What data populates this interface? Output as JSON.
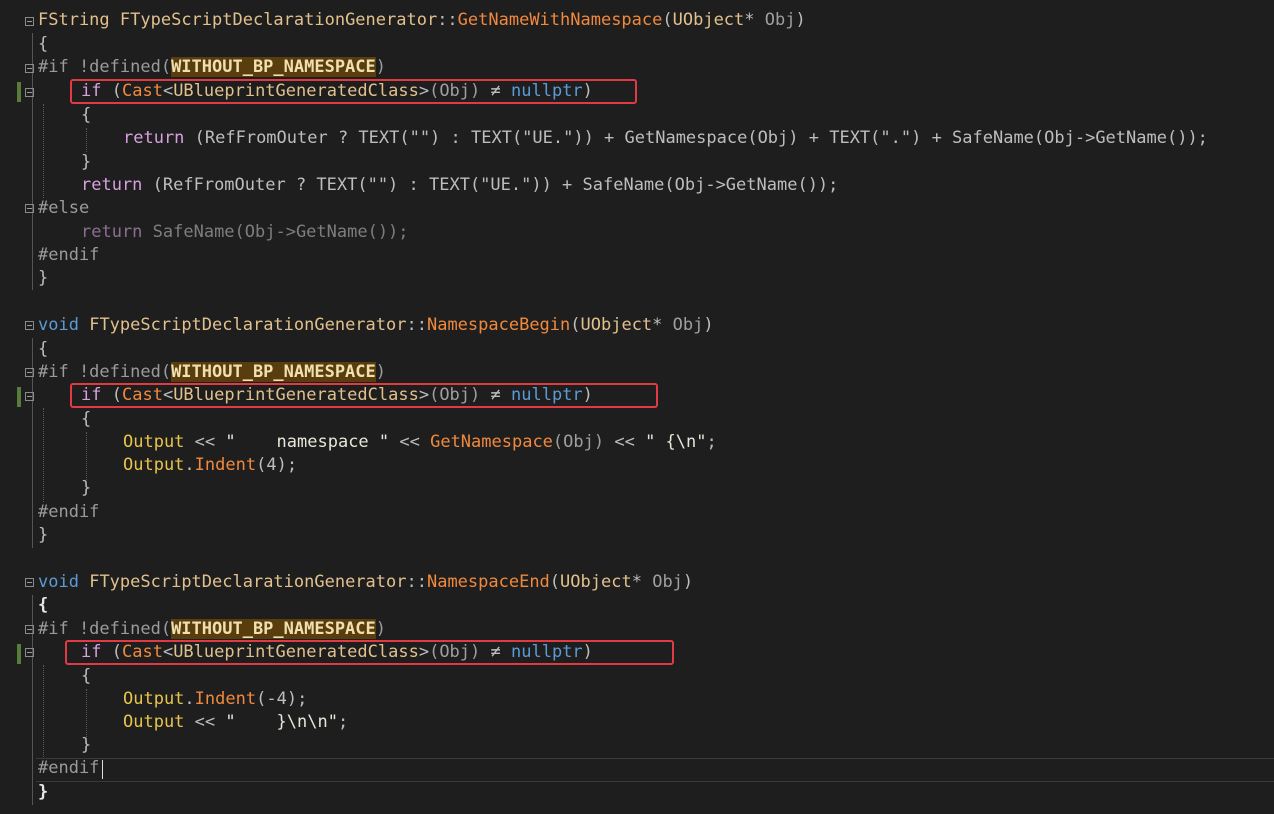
{
  "code": {
    "fn1": {
      "ret": "FString",
      "cls": "FTypeScriptDeclarationGenerator",
      "sep": "::",
      "name": "GetNameWithNamespace",
      "ptype": "UObject",
      "ptr": "*",
      "pname": "Obj",
      "open": "{",
      "if_directive": "#if !defined(",
      "macro": "WITHOUT_BP_NAMESPACE",
      "if_close": ")",
      "if_kw": "if",
      "cast": "Cast",
      "cast_type": "UBlueprintGeneratedClass",
      "cast_arg": "(Obj)",
      "neq": "≠",
      "null": "nullptr",
      "ret_kw": "return",
      "line_return1": " (RefFromOuter ? TEXT(\"\") : TEXT(\"UE.\")) + GetNamespace(Obj) + TEXT(\".\") + SafeName(Obj->GetName());",
      "line_return2": " (RefFromOuter ? TEXT(\"\") : TEXT(\"UE.\")) + SafeName(Obj->GetName());",
      "else_directive": "#else",
      "line_return3": " SafeName(Obj->GetName());",
      "endif": "#endif",
      "close": "}"
    },
    "fn2": {
      "ret": "void",
      "cls": "FTypeScriptDeclarationGenerator",
      "name": "NamespaceBegin",
      "output": "Output",
      "stream": " << ",
      "str1": "\"    namespace \"",
      "call": "GetNamespace",
      "str2": "\" {\\n\"",
      "indent": "Indent",
      "indent_arg": "4"
    },
    "fn3": {
      "ret": "void",
      "cls": "FTypeScriptDeclarationGenerator",
      "name": "NamespaceEnd",
      "indent_arg": "-4",
      "str": "\"    }\\n\\n\""
    }
  },
  "colors": {
    "background": "#1e1e1e",
    "highlight_box": "#e03a44",
    "change_bar": "#587c3a",
    "macro_highlight_bg": "#5a3d0c"
  }
}
